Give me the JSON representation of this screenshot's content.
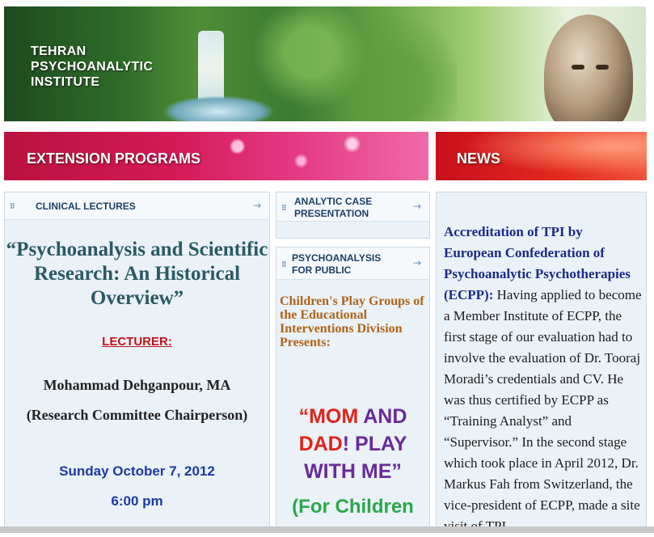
{
  "header": {
    "title_lines": [
      "TEHRAN",
      "PSYCHOANALYTIC",
      "INSTITUTE"
    ]
  },
  "sections": {
    "extension": "EXTENSION PROGRAMS",
    "news": "NEWS"
  },
  "clinical": {
    "header": "CLINICAL LECTURES",
    "lecture_title": "“Psychoanalysis and Scientific Research: An Historical Overview”",
    "lecturer_label": "LECTURER:",
    "lecturer_name": "Mohammad Dehganpour, MA",
    "lecturer_role": "(Research Committee Chairperson)",
    "date": "Sunday October 7, 2012",
    "time": "6:00 pm"
  },
  "case": {
    "header_lines": [
      "ANALYTIC CASE",
      "PRESENTATION"
    ]
  },
  "public": {
    "header_lines": [
      "PSYCHOANALYSIS",
      "FOR PUBLIC"
    ],
    "intro": "Children's Play Groups of the Educational Interventions Division Presents:",
    "play_words": {
      "q1": "“",
      "mom": "MOM",
      "and": " AND",
      "dad": "DAD",
      "bang": "!",
      "play": " PLAY",
      "withme": "WITH ME",
      "q2": "”"
    },
    "subtitle": "(For Children"
  },
  "news": {
    "headline": "Accreditation of TPI by European Confederation of Psychoanalytic Psychotherapies (ECPP):",
    "body": " Having applied to become a Member Institute of ECPP, the first stage of our evaluation had to involve the evaluation of Dr. Tooraj Moradi’s credentials and CV. He was thus certified by ECPP as “Training Analyst” and “Supervisor.” In the second stage which took place in April 2012, Dr. Markus Fah from Switzerland, the vice-president of ECPP, made a site visit of TPI..."
  },
  "icons": {
    "bullet": "grid-bullet-icon",
    "arrow": "arrow-right-icon"
  },
  "colors": {
    "accent_pink": "#d41a57",
    "accent_red": "#e32a1e",
    "navy": "#1a2a8a",
    "teal_title": "#2a5a64"
  }
}
